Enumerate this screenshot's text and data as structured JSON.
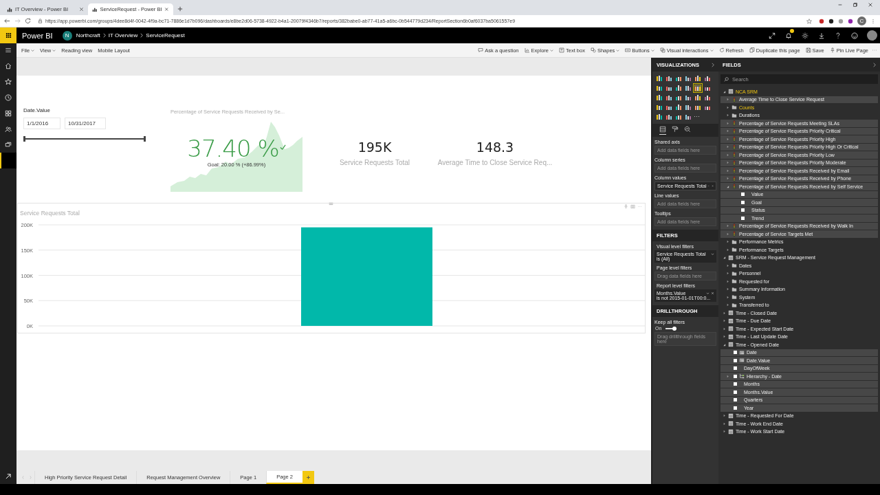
{
  "browser": {
    "tabs": [
      {
        "title": "IT Overview - Power BI",
        "selected": false
      },
      {
        "title": "ServiceRequest - Power BI",
        "selected": true
      }
    ],
    "url": "https://app.powerbi.com/groups/4dee8d4f-0042-4f9a-bc71-7886e1d7b096/dashboards/e8be2d06-5738-4922-b4a1-20079f4346b7/reports/382babe0-ab77-41a5-a6bc-0b544779d234/ReportSection6b0af6037ba5061557e9",
    "profile_initial": "C"
  },
  "header": {
    "app": "Power BI",
    "avatar": "N",
    "breadcrumb": [
      "Northcraft",
      "IT Overview",
      "ServiceRequest"
    ]
  },
  "nav": [
    {
      "selected": false
    },
    {
      "selected": false
    },
    {
      "selected": false
    },
    {
      "selected": false
    },
    {
      "selected": false
    },
    {
      "selected": false
    },
    {
      "selected": true
    }
  ],
  "toolbar": {
    "left": [
      {
        "label": "File",
        "dropdown": true
      },
      {
        "label": "View",
        "dropdown": true
      },
      {
        "label": "Reading view",
        "dropdown": false
      },
      {
        "label": "Mobile Layout",
        "dropdown": false
      }
    ],
    "right": [
      {
        "label": "Ask a question",
        "dropdown": false
      },
      {
        "label": "Explore",
        "dropdown": true
      },
      {
        "label": "Text box",
        "dropdown": false
      },
      {
        "label": "Shapes",
        "dropdown": true
      },
      {
        "label": "Buttons",
        "dropdown": true
      },
      {
        "label": "Visual interactions",
        "dropdown": true
      },
      {
        "label": "Refresh",
        "dropdown": false
      },
      {
        "label": "Duplicate this page",
        "dropdown": false
      },
      {
        "label": "Save",
        "dropdown": false
      },
      {
        "label": "Pin Live Page",
        "dropdown": false
      }
    ]
  },
  "slicer": {
    "title": "Date.Value",
    "from": "1/1/2016",
    "to": "10/31/2017",
    "level": 1
  },
  "kpi": {
    "title": "Percentage of Service Requests Received by Se...",
    "value": "37.40 %",
    "goal": "Goal: 20.00 % (+86.99%)"
  },
  "cards": [
    {
      "value": "195K",
      "label": "Service Requests Total"
    },
    {
      "value": "148.3",
      "label": "Average Time to Close Service Req..."
    }
  ],
  "chart": {
    "chart_data": {
      "type": "bar",
      "title": "Service Requests Total",
      "values": [
        195000
      ],
      "color": "#01b8aa",
      "ylim": [
        0,
        200000
      ],
      "grid": true,
      "yticks": [
        {
          "value": 0,
          "label": "0K"
        },
        {
          "value": 50000,
          "label": "50K"
        },
        {
          "value": 100000,
          "label": "100K"
        },
        {
          "value": 150000,
          "label": "150K"
        },
        {
          "value": 200000,
          "label": "200K"
        }
      ]
    }
  },
  "pages": [
    {
      "label": "High Priority Service Request Detail",
      "selected": false
    },
    {
      "label": "Request Management Overview",
      "selected": false
    },
    {
      "label": "Page 1",
      "selected": false
    },
    {
      "label": "Page 2",
      "selected": true
    }
  ],
  "visualizations": {
    "title": "VISUALIZATIONS",
    "types": [
      {
        "selected": false
      },
      {
        "selected": false
      },
      {
        "selected": false
      },
      {
        "selected": false
      },
      {
        "selected": false
      },
      {
        "selected": false
      },
      {
        "selected": false
      },
      {
        "selected": false
      },
      {
        "selected": false
      },
      {
        "selected": false
      },
      {
        "selected": true
      },
      {
        "selected": false
      },
      {
        "selected": false
      },
      {
        "selected": false
      },
      {
        "selected": false
      },
      {
        "selected": false
      },
      {
        "selected": false
      },
      {
        "selected": false
      },
      {
        "selected": false
      },
      {
        "selected": false
      },
      {
        "selected": false
      },
      {
        "selected": false
      },
      {
        "selected": false
      },
      {
        "selected": false
      },
      {
        "selected": false
      },
      {
        "selected": false
      },
      {
        "selected": false
      },
      {
        "selected": false
      }
    ],
    "more": "···",
    "tabs": [
      {
        "selected": true
      },
      {
        "selected": false
      },
      {
        "selected": false
      }
    ],
    "wells": [
      {
        "label": "Shared axis",
        "placeholder": "Add data fields here"
      },
      {
        "label": "Column series",
        "placeholder": "Add data fields here"
      },
      {
        "label": "Column values",
        "field": "Service Requests Total"
      },
      {
        "label": "Line values",
        "placeholder": "Add data fields here"
      },
      {
        "label": "Tooltips",
        "placeholder": "Add data fields here"
      }
    ]
  },
  "filters": {
    "title": "FILTERS",
    "visual_label": "Visual level filters",
    "visual": [
      {
        "name": "Service Requests Total",
        "condition": "is (All)",
        "removable": false
      }
    ],
    "page_label": "Page level filters",
    "page_placeholder": "Drag data fields here",
    "report_label": "Report level filters",
    "report": [
      {
        "name": "Months.Value",
        "condition": "is not 2015-01-01T00:0...",
        "removable": true
      }
    ]
  },
  "drillthrough": {
    "title": "DRILLTHROUGH",
    "keep_label": "Keep all filters",
    "toggle_label": "On",
    "on": true,
    "placeholder": "Drag drillthrough fields here"
  },
  "fields": {
    "title": "FIELDS",
    "search_placeholder": "Search",
    "tree": [
      {
        "label": "NCA SRM",
        "kind": "table",
        "expanded": true,
        "active": true,
        "children": [
          {
            "label": "Average Time to Close Service Request",
            "kind": "kpi",
            "expanded": false,
            "active": false
          },
          {
            "label": "Counts",
            "kind": "folder",
            "expanded": false,
            "active": true
          },
          {
            "label": "Durations",
            "kind": "folder",
            "expanded": false,
            "active": false
          },
          {
            "label": "Percentage of Service Requests Meeting SLAs",
            "kind": "kpi",
            "expanded": false,
            "active": false
          },
          {
            "label": "Percentage of Service Requests Priority Critical",
            "kind": "kpi",
            "expanded": false,
            "active": false
          },
          {
            "label": "Percentage of Service Requests Priority High",
            "kind": "kpi",
            "expanded": false,
            "active": false
          },
          {
            "label": "Percentage of Service Requests Priority High Or Critical",
            "kind": "kpi",
            "expanded": false,
            "active": false
          },
          {
            "label": "Percentage of Service Requests Priority Low",
            "kind": "kpi",
            "expanded": false,
            "active": false
          },
          {
            "label": "Percentage of Service Requests Priority Moderate",
            "kind": "kpi",
            "expanded": false,
            "active": false
          },
          {
            "label": "Percentage of Service Requests Received by Email",
            "kind": "kpi",
            "expanded": false,
            "active": false
          },
          {
            "label": "Percentage of Service Requests Received by Phone",
            "kind": "kpi",
            "expanded": false,
            "active": false
          },
          {
            "label": "Percentage of Service Requests Received by Self Service",
            "kind": "kpi",
            "expanded": true,
            "active": false,
            "children": [
              {
                "label": "Value",
                "kind": "field",
                "checked": false,
                "active": false
              },
              {
                "label": "Goal",
                "kind": "field",
                "checked": false,
                "active": false
              },
              {
                "label": "Status",
                "kind": "field",
                "checked": false,
                "active": false
              },
              {
                "label": "Trend",
                "kind": "field",
                "checked": false,
                "active": false
              }
            ]
          },
          {
            "label": "Percentage of Service Requests Received by Walk In",
            "kind": "kpi",
            "expanded": false,
            "active": false
          },
          {
            "label": "Percentage of Service Targets Met",
            "kind": "kpi",
            "expanded": false,
            "active": false
          },
          {
            "label": "Performance Metrics",
            "kind": "folder",
            "expanded": false,
            "active": false
          },
          {
            "label": "Performance Targets",
            "kind": "folder",
            "expanded": false,
            "active": false
          }
        ]
      },
      {
        "label": "SRM - Service Request Management",
        "kind": "table",
        "expanded": true,
        "active": false,
        "children": [
          {
            "label": "Dates",
            "kind": "folder",
            "expanded": false,
            "active": false
          },
          {
            "label": "Personnel",
            "kind": "folder",
            "expanded": false,
            "active": false
          },
          {
            "label": "Requested for",
            "kind": "folder",
            "expanded": false,
            "active": false
          },
          {
            "label": "Summary Information",
            "kind": "folder",
            "expanded": false,
            "active": false
          },
          {
            "label": "System",
            "kind": "folder",
            "expanded": false,
            "active": false
          },
          {
            "label": "Transferred to",
            "kind": "folder",
            "expanded": false,
            "active": false
          }
        ]
      },
      {
        "label": "Time - Closed Date",
        "kind": "table",
        "expanded": false,
        "active": false
      },
      {
        "label": "Time - Due Date",
        "kind": "table",
        "expanded": false,
        "active": false
      },
      {
        "label": "Time - Expected Start Date",
        "kind": "table",
        "expanded": false,
        "active": false
      },
      {
        "label": "Time - Last Update Date",
        "kind": "table",
        "expanded": false,
        "active": false
      },
      {
        "label": "Time - Opened Date",
        "kind": "table",
        "expanded": true,
        "active": false,
        "children": [
          {
            "label": "Date",
            "kind": "datefield",
            "checked": false,
            "active": false
          },
          {
            "label": "Date.Value",
            "kind": "datefield",
            "checked": false,
            "active": false
          },
          {
            "label": "DayOfWeek",
            "kind": "field",
            "checked": false,
            "active": false
          },
          {
            "label": "Hierarchy - Date",
            "kind": "hierarchy",
            "expanded": false,
            "checked": false,
            "active": false
          },
          {
            "label": "Months",
            "kind": "field",
            "checked": false,
            "active": false
          },
          {
            "label": "Months.Value",
            "kind": "field",
            "checked": false,
            "active": false
          },
          {
            "label": "Quarters",
            "kind": "field",
            "checked": false,
            "active": false
          },
          {
            "label": "Year",
            "kind": "field",
            "checked": false,
            "active": false
          }
        ]
      },
      {
        "label": "Time - Requested For Date",
        "kind": "table",
        "expanded": false,
        "active": false
      },
      {
        "label": "Time - Work End Date",
        "kind": "table",
        "expanded": false,
        "active": false
      },
      {
        "label": "Time - Work Start Date",
        "kind": "table",
        "expanded": false,
        "active": false
      }
    ]
  }
}
